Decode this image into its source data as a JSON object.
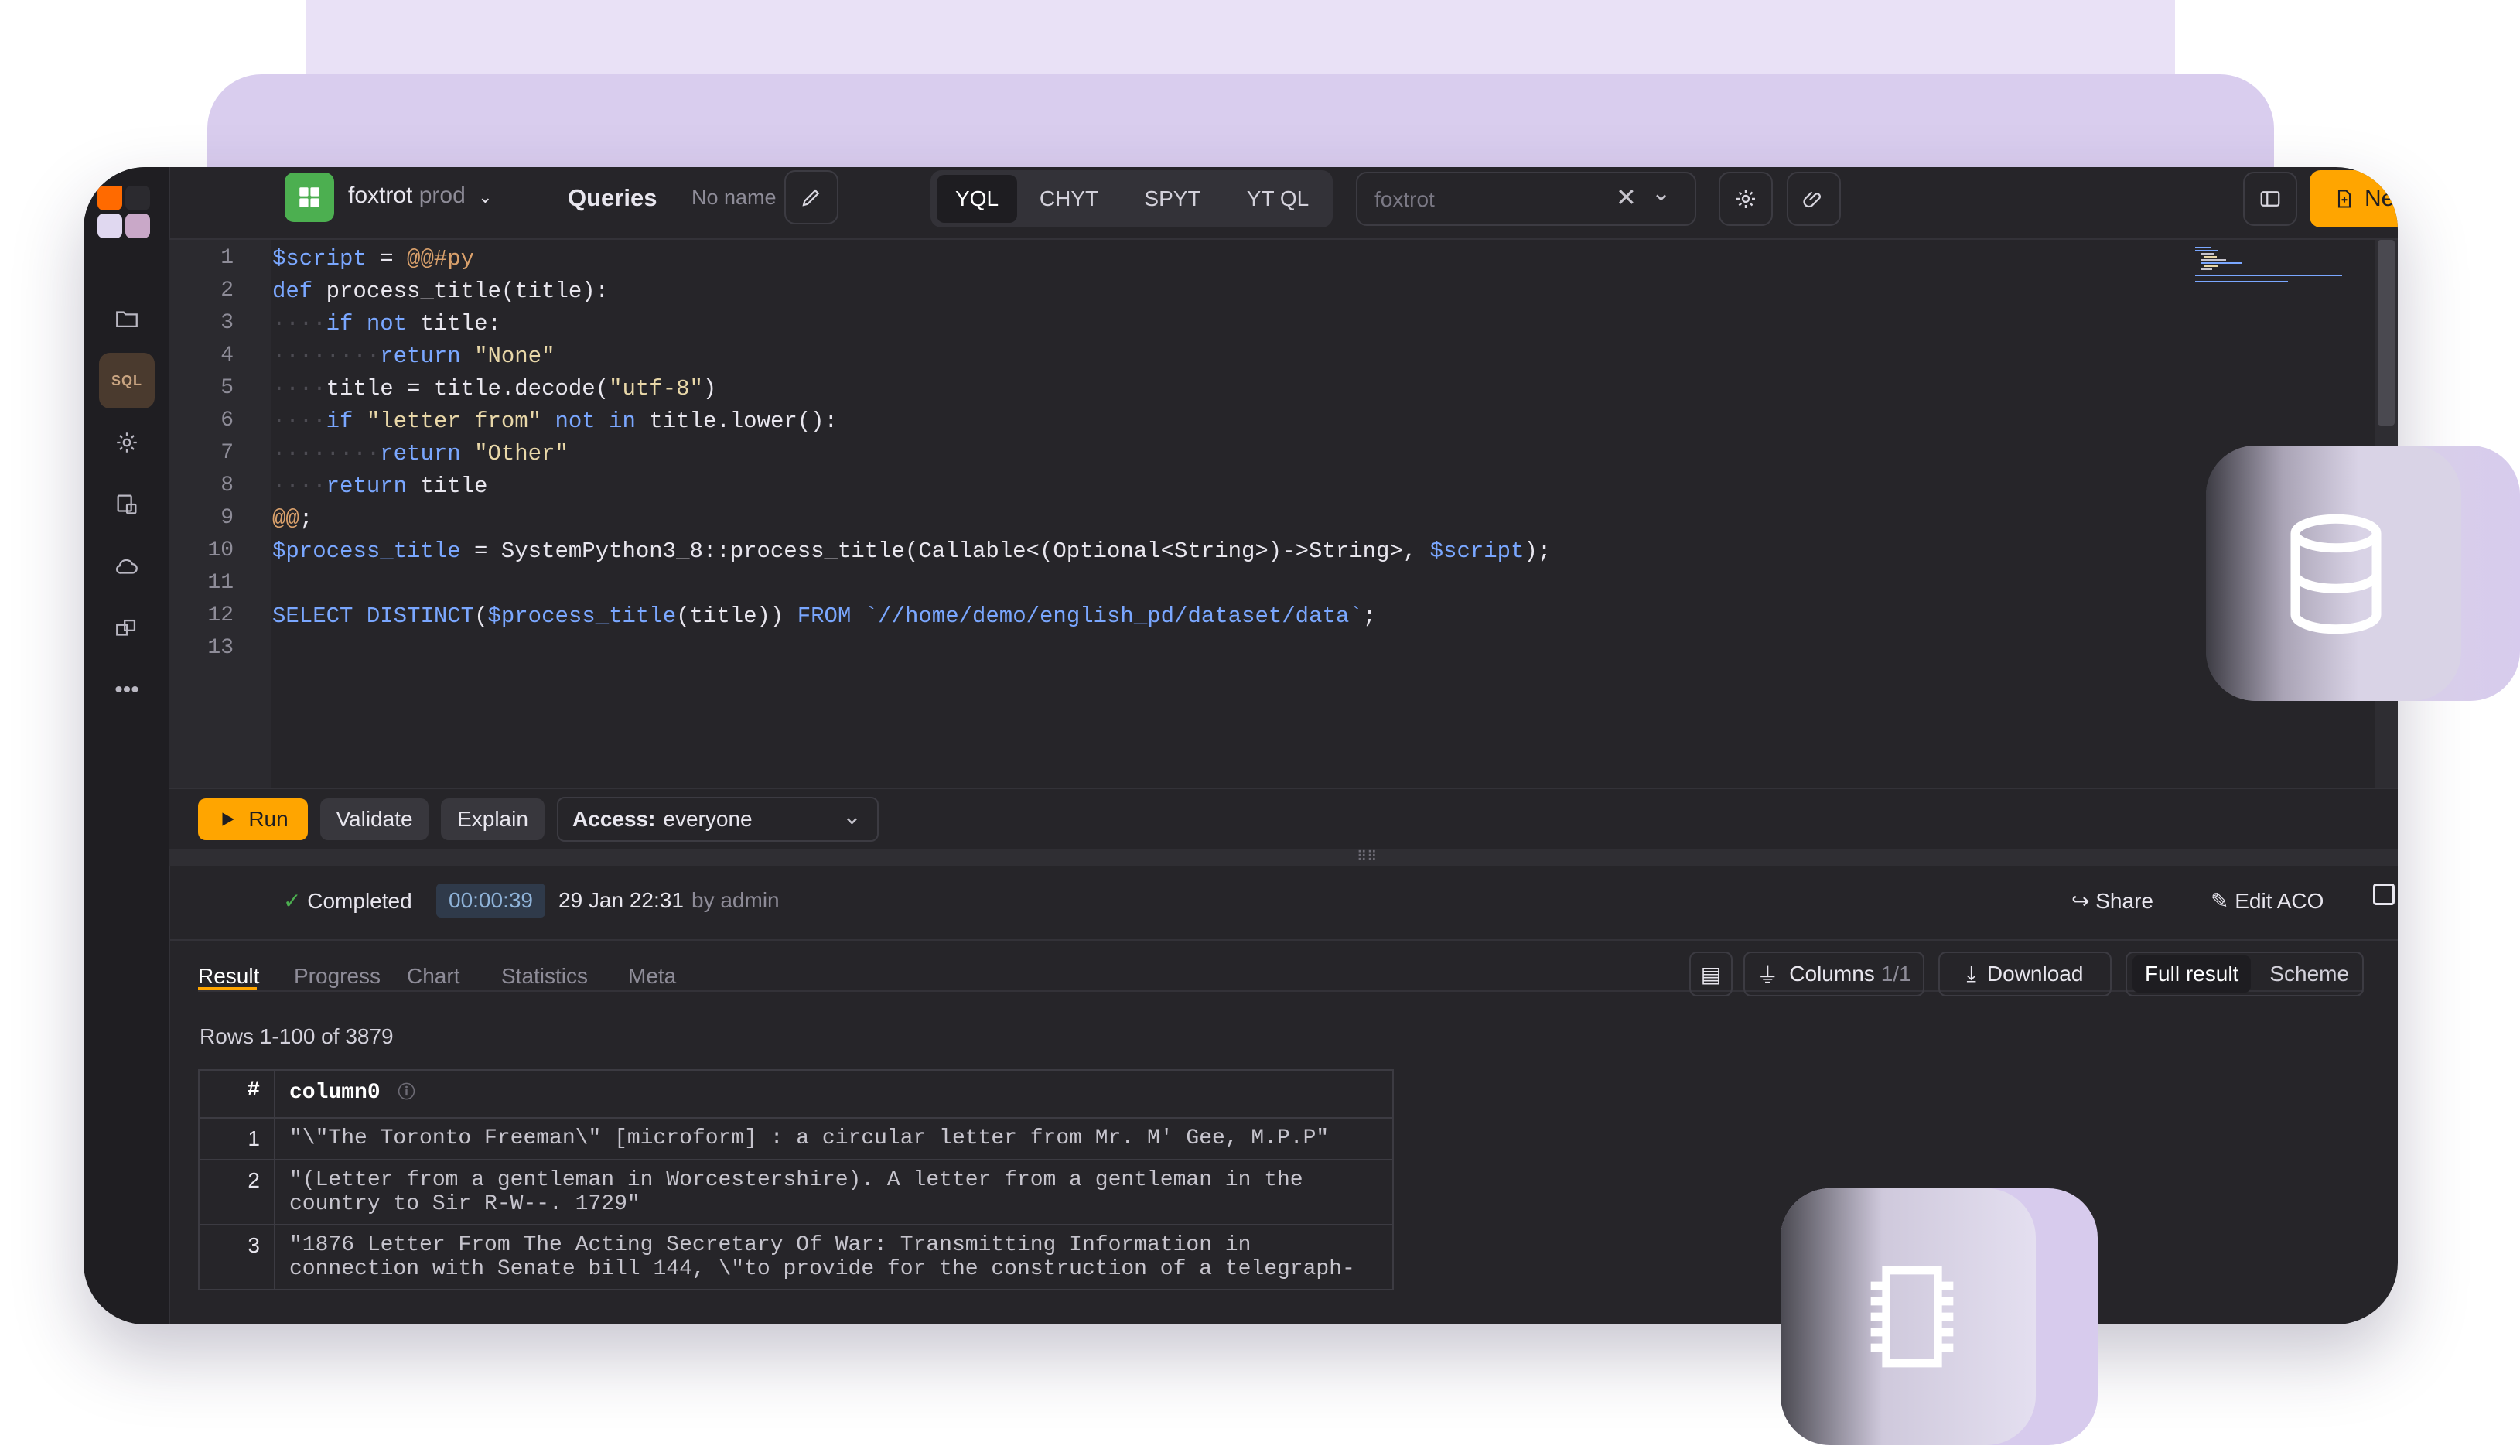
{
  "topbar": {
    "cluster_name": "foxtrot",
    "cluster_env": "prod",
    "section_title": "Queries",
    "query_name": "No name",
    "engines": [
      "YQL",
      "CHYT",
      "SPYT",
      "YT QL"
    ],
    "active_engine": "YQL",
    "cluster_select_value": "foxtrot",
    "new_label": "New"
  },
  "sidebar": {
    "items": [
      "folder-icon",
      "sql",
      "gear-icon",
      "tasks-icon",
      "cloud-icon",
      "packages-icon",
      "more-icon"
    ],
    "sql_label": "SQL"
  },
  "editor": {
    "line_numbers": [
      "1",
      "2",
      "3",
      "4",
      "5",
      "6",
      "7",
      "8",
      "9",
      "10",
      "11",
      "12",
      "13"
    ],
    "code": [
      "$script = @@#py",
      "def process_title(title):",
      "    if not title:",
      "        return \"None\"",
      "    title = title.decode(\"utf-8\")",
      "    if \"letter from\" not in title.lower():",
      "        return \"Other\"",
      "    return title",
      "@@;",
      "$process_title = SystemPython3_8::process_title(Callable<(Optional<String>)->String>, $script);",
      "",
      "SELECT DISTINCT($process_title(title)) FROM `//home/demo/english_pd/dataset/data`;",
      ""
    ]
  },
  "actions": {
    "run_label": "Run",
    "validate_label": "Validate",
    "explain_label": "Explain",
    "access_label": "Access:",
    "access_value": "everyone"
  },
  "status": {
    "state": "Completed",
    "duration": "00:00:39",
    "date": "29 Jan 22:31",
    "by": "by admin",
    "share_label": "Share",
    "edit_aco_label": "Edit ACO"
  },
  "result_tabs": [
    "Result",
    "Progress",
    "Chart",
    "Statistics",
    "Meta"
  ],
  "result_toolbar": {
    "columns_label": "Columns",
    "columns_count": "1/1",
    "download_label": "Download",
    "full_result_label": "Full result",
    "scheme_label": "Scheme"
  },
  "results": {
    "rows_info": "Rows 1-100 of 3879",
    "headers": [
      "#",
      "column0"
    ],
    "rows": [
      {
        "n": "1",
        "value": "\"\\\"The Toronto Freeman\\\" [microform] : a circular letter from Mr. M' Gee, M.P.P\""
      },
      {
        "n": "2",
        "value": "\"(Letter from a gentleman in Worcestershire). A letter from a gentleman in the country to Sir R-W--. 1729\""
      },
      {
        "n": "3",
        "value": "\"1876 Letter From The Acting Secretary Of War: Transmitting Information in connection with Senate bill 144, \\\"to provide for the construction of a telegraph-"
      }
    ]
  },
  "colors": {
    "accent": "#ffa500",
    "cluster_icon": "#4caf50",
    "background": "#262529",
    "deco_light": "#e9e1f6",
    "deco_mid": "#d9cdee"
  }
}
